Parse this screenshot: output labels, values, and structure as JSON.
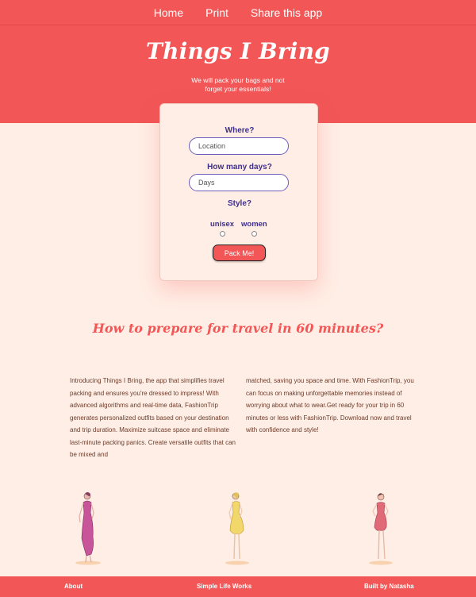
{
  "nav": {
    "items": [
      "Home",
      "Print",
      "Share this app"
    ]
  },
  "header": {
    "title": "Things I Bring",
    "subtitle": "We will pack your bags and not forget your essentials!"
  },
  "form": {
    "where_label": "Where?",
    "location_placeholder": "Location",
    "days_label": "How many days?",
    "days_placeholder": "Days",
    "style_label": "Style?",
    "option_unisex": "unisex",
    "option_women": "women",
    "submit_label": "Pack Me!"
  },
  "section": {
    "heading": "How to prepare for travel in 60 minutes?",
    "col1": "Introducing Things I Bring, the app that simplifies travel packing and ensures you're dressed to impress! With advanced algorithms and real-time data, FashionTrip generates personalized outfits based on your destination and trip duration. Maximize suitcase space and eliminate last-minute packing panics. Create versatile outfits that can be mixed and",
    "col2": "matched, saving you space and time. With FashionTrip, you can focus on making unforgettable memories instead of worrying about what to wear.Get ready for your trip in 60 minutes or less with FashionTrip. Download now and travel with confidence and style!"
  },
  "illustrations": [
    "fashion-figure-magenta-dress",
    "fashion-figure-yellow-dress",
    "fashion-figure-pink-dress"
  ],
  "footer": {
    "about": "About",
    "center": "Simple Life Works",
    "credit": "Built by Natasha"
  },
  "colors": {
    "accent": "#f25656",
    "background": "#ffeee5",
    "label": "#3e2f8c"
  }
}
